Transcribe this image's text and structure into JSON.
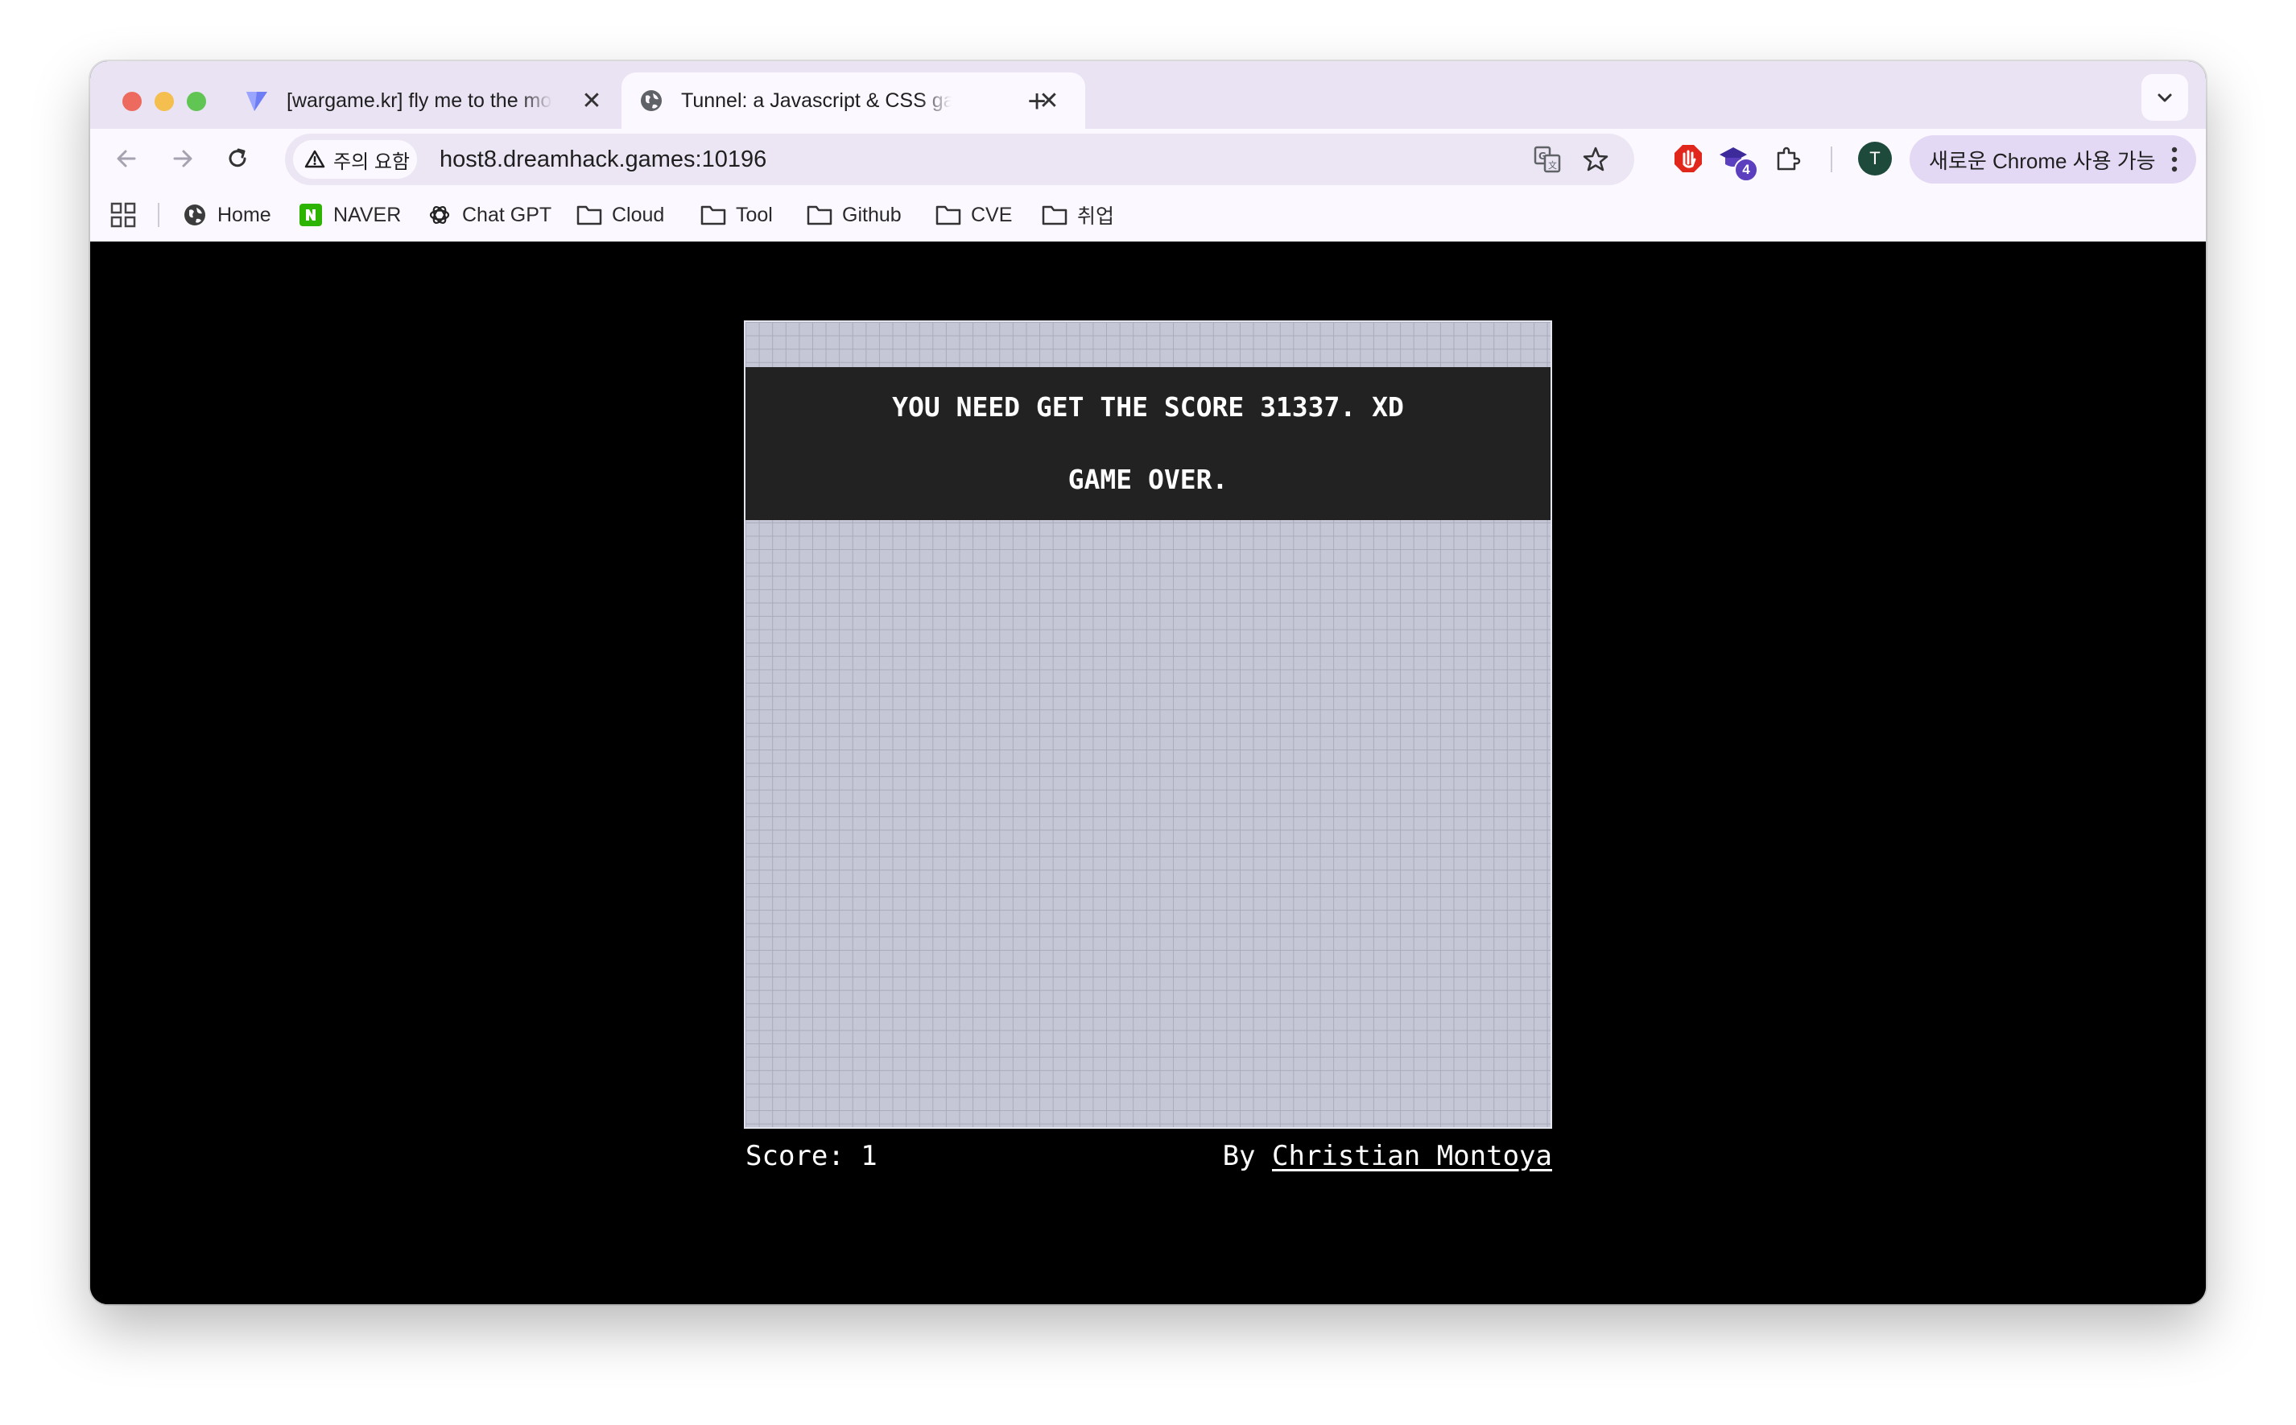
{
  "browser": {
    "tabs": [
      {
        "title": "[wargame.kr] fly me to the moon",
        "favicon": "wargame-logo-icon",
        "active": false
      },
      {
        "title": "Tunnel: a Javascript & CSS game",
        "favicon": "globe-icon",
        "active": true
      }
    ],
    "address_bar": {
      "security_label": "주의 요함",
      "url": "host8.dreamhack.games:10196"
    },
    "extension_badge": "4",
    "profile_initial": "T",
    "update_button_label": "새로운 Chrome 사용 가능",
    "bookmarks": [
      {
        "label": "Home",
        "icon": "globe-icon"
      },
      {
        "label": "NAVER",
        "icon": "naver-icon"
      },
      {
        "label": "Chat GPT",
        "icon": "openai-icon"
      },
      {
        "label": "Cloud",
        "icon": "folder-icon"
      },
      {
        "label": "Tool",
        "icon": "folder-icon"
      },
      {
        "label": "Github",
        "icon": "folder-icon"
      },
      {
        "label": "CVE",
        "icon": "folder-icon"
      },
      {
        "label": "취업",
        "icon": "folder-icon"
      }
    ]
  },
  "game": {
    "message_line1": "YOU NEED GET THE SCORE 31337. XD",
    "message_line2": "GAME OVER.",
    "score_text": "Score: 1",
    "by_prefix": "By",
    "author": "Christian Montoya"
  },
  "colors": {
    "tabstrip_bg": "#e9e3f3",
    "toolbar_bg": "#fbf8ff",
    "board_bg": "#c5c7d6",
    "overlay_bg": "#222222",
    "page_bg": "#000000"
  }
}
